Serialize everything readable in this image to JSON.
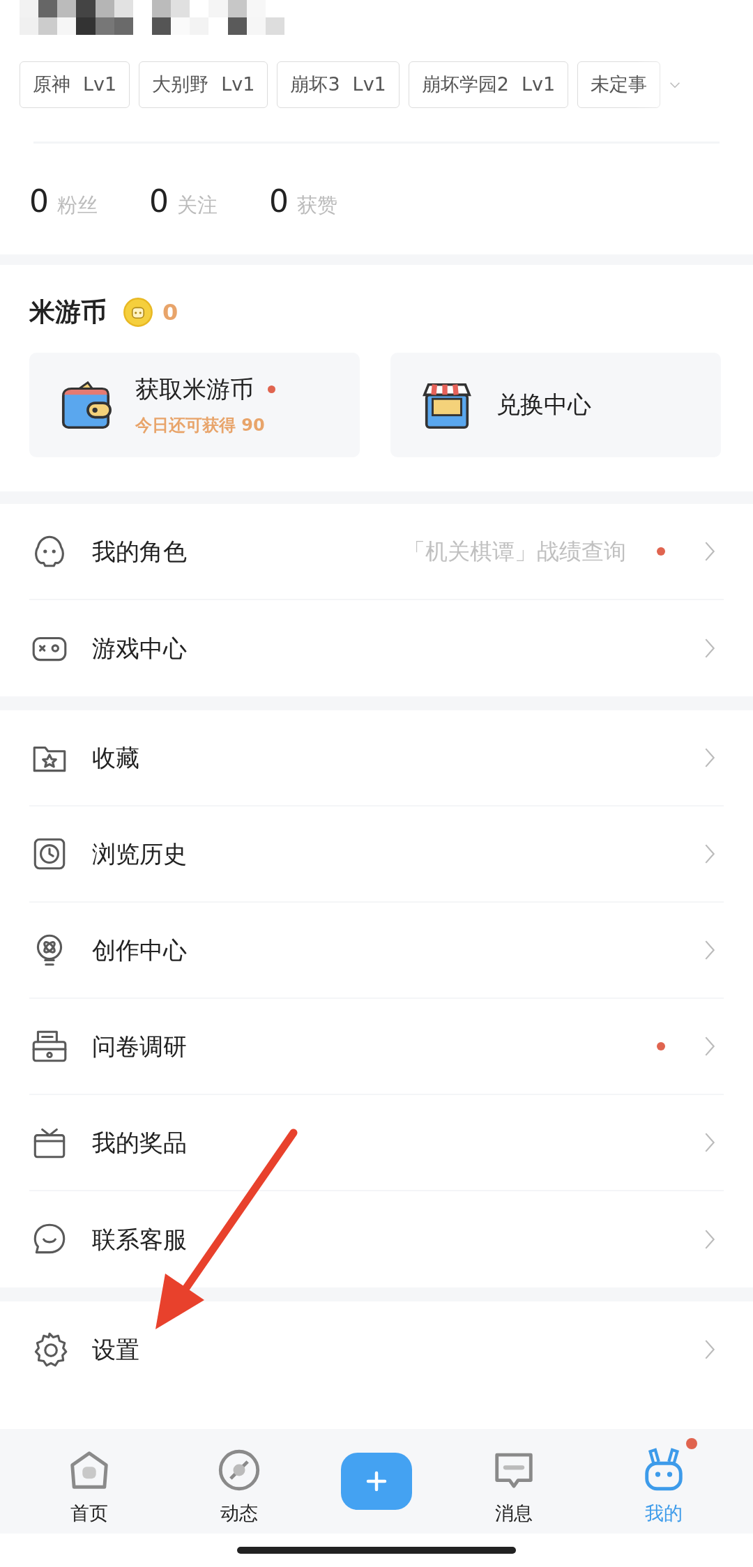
{
  "profile": {
    "game_tags": [
      {
        "name": "原神",
        "level": "Lv1"
      },
      {
        "name": "大别野",
        "level": "Lv1"
      },
      {
        "name": "崩坏3",
        "level": "Lv1"
      },
      {
        "name": "崩坏学园2",
        "level": "Lv1"
      },
      {
        "name": "未定事"
      }
    ],
    "stats": [
      {
        "count": "0",
        "label": "粉丝"
      },
      {
        "count": "0",
        "label": "关注"
      },
      {
        "count": "0",
        "label": "获赞"
      }
    ]
  },
  "coins": {
    "title": "米游币",
    "balance": "0",
    "cards": [
      {
        "kind": "wallet",
        "title": "获取米游币",
        "badge": true,
        "subtitle": "今日还可获得 90"
      },
      {
        "kind": "shop",
        "title": "兑换中心",
        "badge": false
      }
    ]
  },
  "menu_groups": [
    [
      {
        "label": "我的角色",
        "hint": "「机关棋谭」战绩查询",
        "badge": true
      },
      {
        "label": "游戏中心",
        "badge": false
      }
    ],
    [
      {
        "label": "收藏",
        "badge": false
      },
      {
        "label": "浏览历史",
        "badge": false
      },
      {
        "label": "创作中心",
        "badge": false
      },
      {
        "label": "问卷调研",
        "badge": true
      },
      {
        "label": "我的奖品",
        "badge": false
      },
      {
        "label": "联系客服",
        "badge": false
      }
    ],
    [
      {
        "label": "设置",
        "badge": false
      }
    ]
  ],
  "bottom_nav": [
    {
      "kind": "tab",
      "label": "首页",
      "selected": false,
      "badge": false
    },
    {
      "kind": "tab",
      "label": "动态",
      "selected": false,
      "badge": false
    },
    {
      "kind": "add"
    },
    {
      "kind": "tab",
      "label": "消息",
      "selected": false,
      "badge": false
    },
    {
      "kind": "tab",
      "label": "我的",
      "selected": true,
      "badge": true
    }
  ]
}
